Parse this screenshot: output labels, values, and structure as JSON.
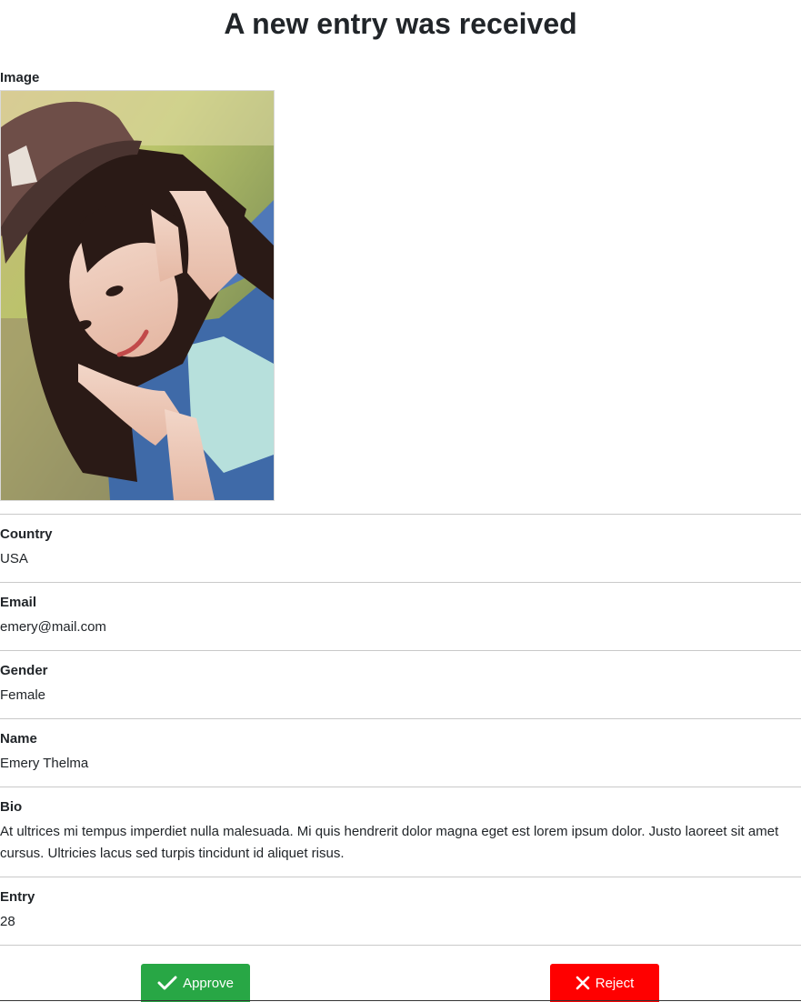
{
  "page": {
    "title": "A new entry was received"
  },
  "image_field": {
    "label": "Image",
    "alt": "Photo of a young woman with long dark hair wearing a cap and denim jacket"
  },
  "fields": {
    "country": {
      "label": "Country",
      "value": "USA"
    },
    "email": {
      "label": "Email",
      "value": "emery@mail.com"
    },
    "gender": {
      "label": "Gender",
      "value": "Female"
    },
    "name": {
      "label": "Name",
      "value": "Emery Thelma"
    },
    "bio": {
      "label": "Bio",
      "value": "At ultrices mi tempus imperdiet nulla malesuada. Mi quis hendrerit dolor magna eget est lorem ipsum dolor. Justo laoreet sit amet cursus. Ultricies lacus sed turpis tincidunt id aliquet risus."
    },
    "entry": {
      "label": "Entry",
      "value": "28"
    }
  },
  "actions": {
    "approve": {
      "label": "Approve",
      "icon": "check-icon",
      "color": "#28a745"
    },
    "reject": {
      "label": "Reject",
      "icon": "x-icon",
      "color": "#ff0000"
    }
  }
}
